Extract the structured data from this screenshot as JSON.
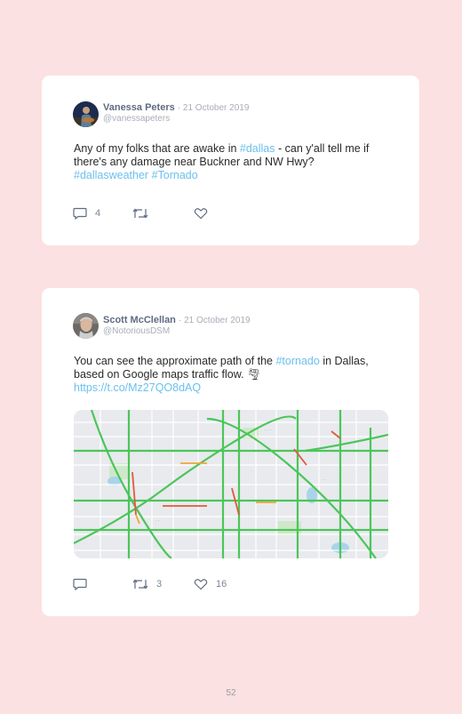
{
  "tweets": [
    {
      "name": "Vanessa Peters",
      "date": "· 21 October 2019",
      "handle": "@vanessapeters",
      "line1_a": "Any of my folks that are awake in ",
      "line1_link": "#dallas",
      "line1_b": " - can y'all tell me if",
      "line2": "there's any damage near Buckner and NW Hwy?",
      "line3_link1": "#dallasweather",
      "line3_link2": "#Tornado",
      "replies": "4",
      "retweets": "",
      "likes": ""
    },
    {
      "name": "Scott McClellan",
      "date": "· 21 October 2019",
      "handle": "@NotoriousDSM",
      "line1_a": "You can see the approximate path of the ",
      "line1_link": "#tornado",
      "line1_b": " in Dallas,",
      "line2": "based on Google maps traffic flow. 🌪",
      "line3_link": "https://t.co/Mz27QO8dAQ",
      "replies": "",
      "retweets": "3",
      "likes": "16"
    }
  ],
  "page_number": "52",
  "colors": {
    "background": "#fbe1e1",
    "link": "#6cc0ee",
    "name": "#5f6b82",
    "icon": "#5f6b82"
  },
  "icons": [
    "reply-icon",
    "retweet-icon",
    "like-icon"
  ]
}
